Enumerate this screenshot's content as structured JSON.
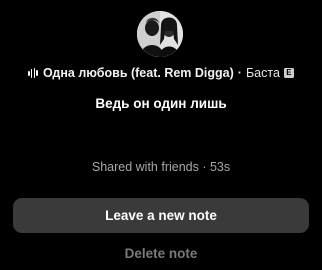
{
  "avatar": {
    "icon": "profile-avatar-icon"
  },
  "track": {
    "icon": "equalizer-icon",
    "title": "Одна любовь (feat. Rem Digga)",
    "separator": "·",
    "artist": "Баста",
    "explicit_badge": "E"
  },
  "note": {
    "text": "Ведь он один лишь"
  },
  "status": {
    "shared_text": "Shared with friends · 53s"
  },
  "actions": {
    "leave_label": "Leave a new note",
    "delete_label": "Delete note"
  },
  "colors": {
    "background": "#000000",
    "button_background": "#3a3a3a",
    "secondary_text": "#a8a8a8",
    "disabled_text": "#7a7a7a"
  }
}
